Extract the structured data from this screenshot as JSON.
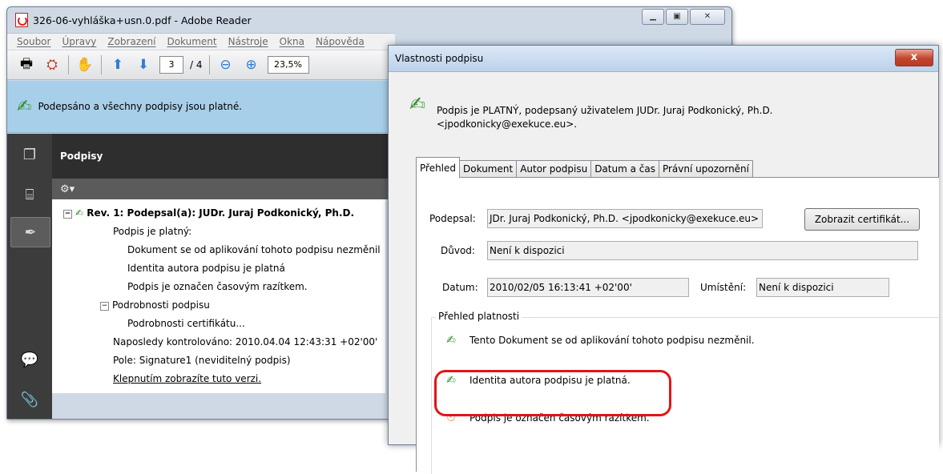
{
  "reader": {
    "title": "326-06-vyhláška+usn.0.pdf - Adobe Reader",
    "menu": [
      "Soubor",
      "Úpravy",
      "Zobrazení",
      "Dokument",
      "Nástroje",
      "Okna",
      "Nápověda"
    ],
    "page_current": "3",
    "page_total": "/ 4",
    "zoom": "23,5%",
    "banner_text": "Podepsáno a všechny podpisy jsou platné.",
    "panel_title": "Podpisy",
    "tree": {
      "rev": "Rev. 1: Podepsal(a): JUDr. Juraj Podkonický, Ph.D.",
      "valid": "Podpis je platný:",
      "unchanged": "Dokument se od aplikování tohoto podpisu nezměnil",
      "identity": "Identita autora podpisu je platná",
      "timestamp": "Podpis je označen časovým razítkem.",
      "details": "Podrobnosti podpisu",
      "cert_details": "Podrobnosti certifikátu...",
      "last_checked": "Naposledy kontrolováno: 2010.04.04 12:43:31 +02'00'",
      "field": "Pole: Signature1 (neviditelný podpis)",
      "show_version": "Klepnutím zobrazíte tuto verzi."
    }
  },
  "dialog": {
    "title": "Vlastnosti podpisu",
    "close": "x",
    "summary": "Podpis je PLATNÝ, podepsaný uživatelem JUDr. Juraj Podkonický, Ph.D. <jpodkonicky@exekuce.eu>.",
    "tabs": [
      "Přehled",
      "Dokument",
      "Autor podpisu",
      "Datum a čas",
      "Právní upozornění"
    ],
    "signed_by_label": "Podepsal:",
    "signed_by_value": "JDr. Juraj Podkonický, Ph.D. <jpodkonicky@exekuce.eu>",
    "show_cert_button": "Zobrazit certifikát...",
    "reason_label": "Důvod:",
    "reason_value": "Není k dispozici",
    "date_label": "Datum:",
    "date_value": "2010/02/05 16:13:41 +02'00'",
    "location_label": "Umístění:",
    "location_value": "Není k dispozici",
    "validity_legend": "Přehled platnosti",
    "validity": [
      "Tento Dokument se od aplikování tohoto podpisu nezměnil.",
      "Identita autora podpisu je platná.",
      "Podpis je označen časovým razítkem."
    ]
  },
  "colors": {
    "banner": "#a8cfe9",
    "rail": "#3c3c3c",
    "panel_header": "#2e2e2e",
    "highlight": "#e3141a",
    "valid_check": "#2f8e2a"
  }
}
